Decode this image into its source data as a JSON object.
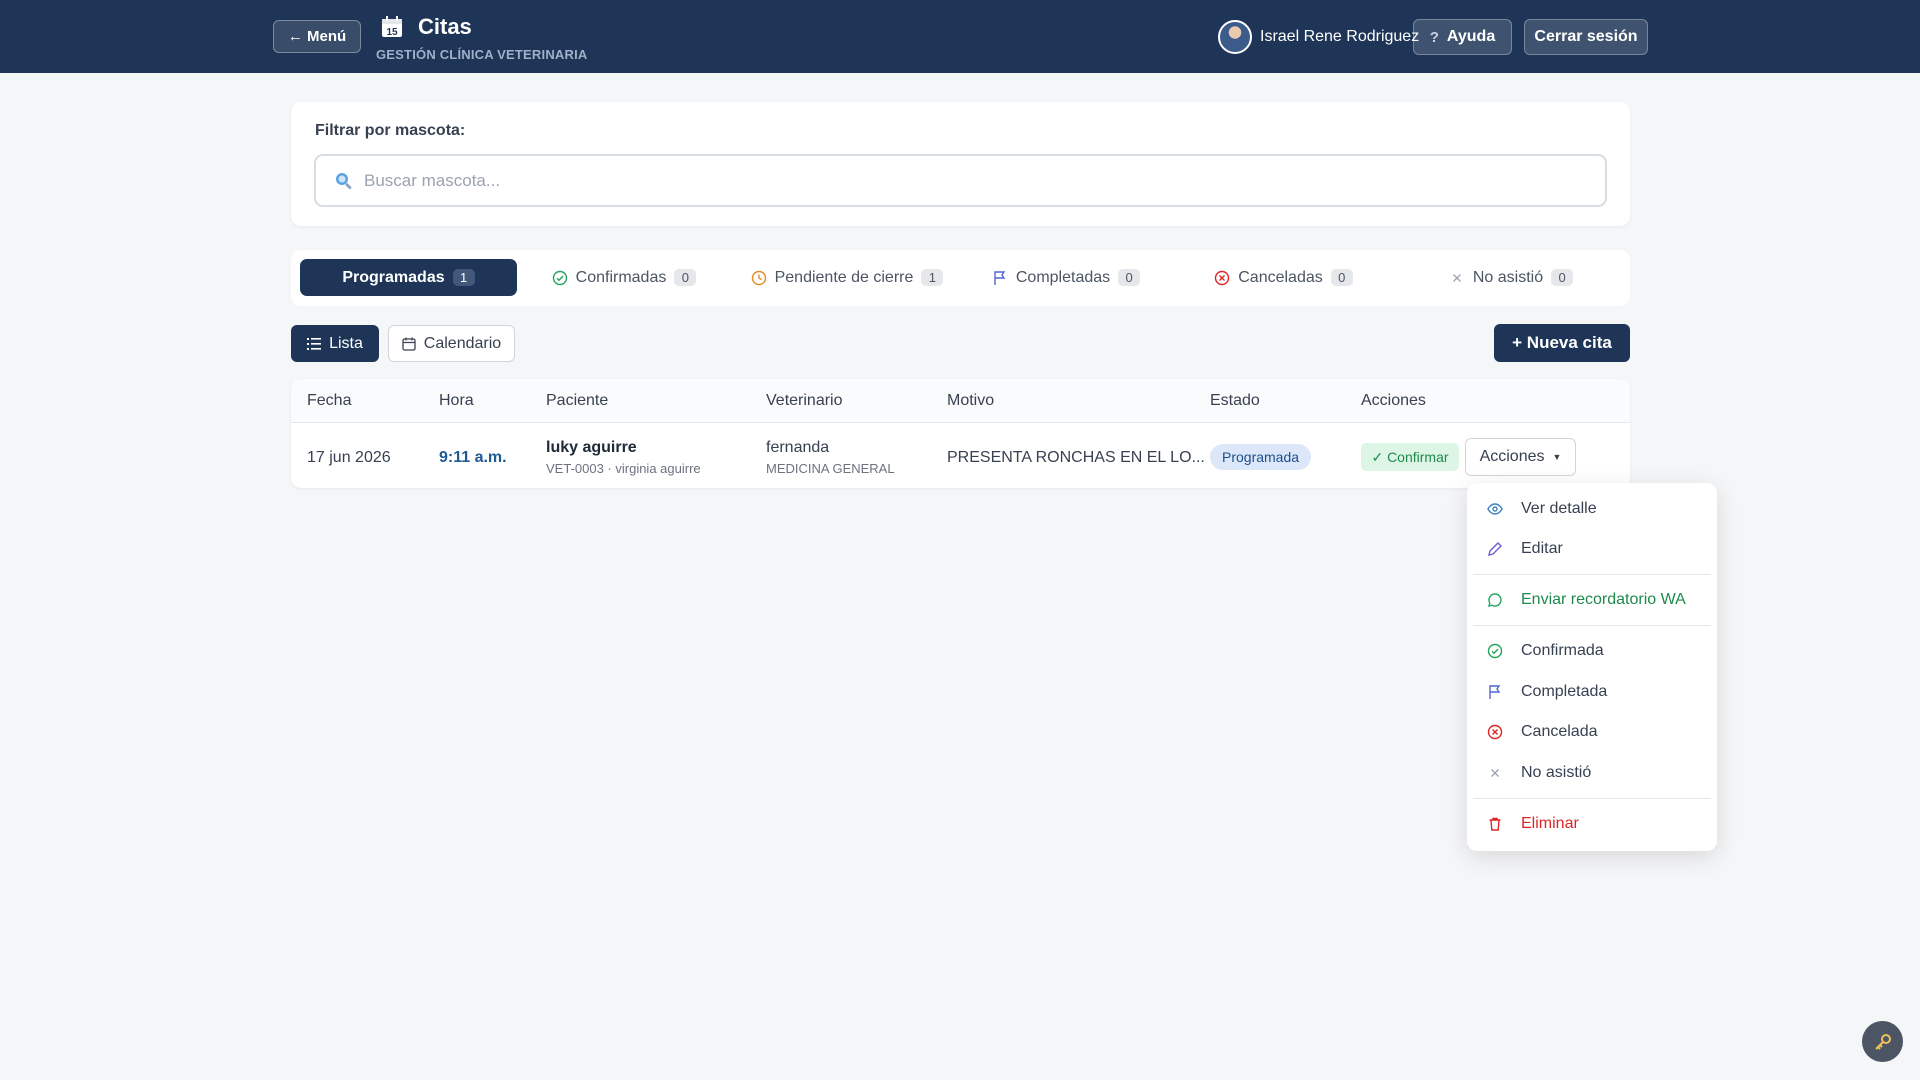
{
  "header": {
    "menu_label": "← Menú",
    "title": "Citas",
    "subtitle": "GESTIÓN CLÍNICA VETERINARIA",
    "user_name": "Israel Rene Rodriguez",
    "help_label": "Ayuda",
    "logout_label": "Cerrar sesión"
  },
  "filter": {
    "label": "Filtrar por mascota:",
    "placeholder": "Buscar mascota...",
    "value": ""
  },
  "tabs": [
    {
      "label": "Programadas",
      "count": "1",
      "icon": "calendar-icon",
      "active": true
    },
    {
      "label": "Confirmadas",
      "count": "0",
      "icon": "check-circle-icon"
    },
    {
      "label": "Pendiente de cierre",
      "count": "1",
      "icon": "clock-icon"
    },
    {
      "label": "Completadas",
      "count": "0",
      "icon": "flag-icon"
    },
    {
      "label": "Canceladas",
      "count": "0",
      "icon": "x-circle-icon"
    },
    {
      "label": "No asistió",
      "count": "0",
      "icon": "x-icon"
    }
  ],
  "views": {
    "list_label": "Lista",
    "calendar_label": "Calendario",
    "new_label": "+ Nueva cita"
  },
  "table": {
    "columns": [
      "Fecha",
      "Hora",
      "Paciente",
      "Veterinario",
      "Motivo",
      "Estado",
      "Acciones"
    ],
    "rows": [
      {
        "fecha": "17 jun 2026",
        "hora": "9:11 a.m.",
        "paciente": "luky aguirre",
        "paciente_sub": "VET-0003 · virginia aguirre",
        "veterinario": "fernanda",
        "veterinario_sub": "MEDICINA GENERAL",
        "motivo": "PRESENTA RONCHAS EN EL LO...",
        "estado": "Programada",
        "confirm_label": "✓ Confirmar",
        "actions_label": "Acciones"
      }
    ]
  },
  "actions_menu": {
    "items": [
      {
        "label": "Ver detalle",
        "icon": "eye-icon"
      },
      {
        "label": "Editar",
        "icon": "pencil-icon"
      },
      {
        "label": "Enviar recordatorio WA",
        "icon": "chat-bubble-icon"
      },
      {
        "label": "Confirmada",
        "icon": "check-circle-icon"
      },
      {
        "label": "Completada",
        "icon": "flag-icon"
      },
      {
        "label": "Cancelada",
        "icon": "x-circle-icon"
      },
      {
        "label": "No asistió",
        "icon": "x-icon"
      },
      {
        "label": "Eliminar",
        "icon": "trash-icon"
      }
    ]
  },
  "colors": {
    "primary": "#1e3557",
    "success": "#1f8a4c",
    "danger": "#dc2626",
    "status_pill_bg": "#dce8fa"
  }
}
